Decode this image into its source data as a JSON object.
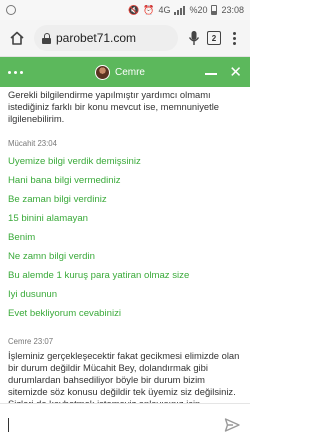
{
  "status_bar": {
    "network": "4G",
    "battery": "%20",
    "time": "23:08"
  },
  "browser": {
    "url": "parobet71.com",
    "tab_count": "2"
  },
  "chat": {
    "agent_name": "Cemre",
    "header_color": "#5cb85c",
    "user_text_color": "#3aaa3a",
    "messages_intro": "Gerekli bilgilendirme yapılmıştır yardımcı olmamı istediğiniz farklı bir konu mevcut ise, memnuniyetle ilgilenebilirim.",
    "user_sender": "Mücahit 23:04",
    "user_lines": [
      "Uyemize bilgi verdik demişsiniz",
      "Hani bana bilgi vermediniz",
      "Be zaman bilgi verdiniz",
      "15 binini alamayan",
      "Benim",
      "Ne zamn bilgi verdin",
      "Bu alemde 1 kuruş para yatiran olmaz size",
      "Iyi dusunun",
      "Evet bekliyorum cevabinizi"
    ],
    "agent_sender": "Cemre 23:07",
    "agent_reply": "İşleminiz gerçekleşecektir fakat gecikmesi elimizde olan bir durum değildir Mücahit Bey, dolandırmak gibi durumlardan bahsediliyor böyle bir durum bizim sitemizde söz konusu değildir tek üyemiz siz değilsiniz. Sizleri de kaybetmek istemeyiz anlayışınız için teşekkürler.",
    "composer_placeholder": ""
  }
}
